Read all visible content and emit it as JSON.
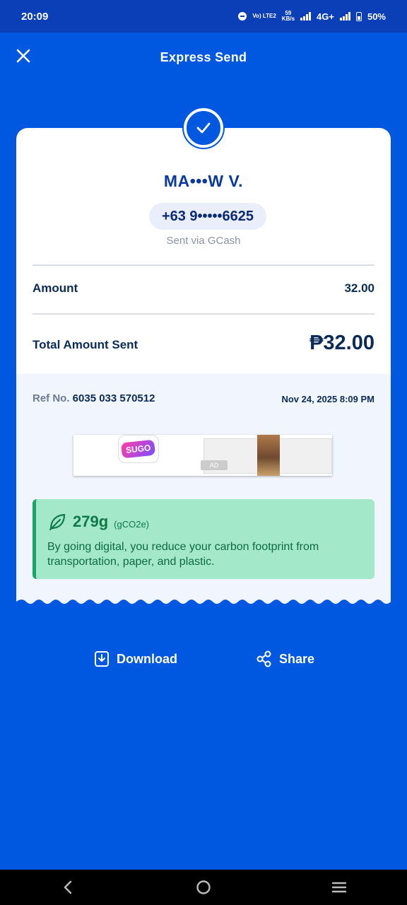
{
  "status_bar": {
    "time": "20:09",
    "volte": "Vo) LTE2",
    "speed_top": "59",
    "speed_bottom": "KB/s",
    "network": "4G+",
    "battery": "50%"
  },
  "header": {
    "title": "Express Send"
  },
  "recipient": {
    "name": "MA•••W V.",
    "phone": "+63 9•••••6625",
    "via": "Sent via GCash"
  },
  "summary": {
    "amount_label": "Amount",
    "amount_value": "32.00",
    "total_label": "Total Amount Sent",
    "total_value": "₱32.00"
  },
  "reference": {
    "label": "Ref No.",
    "number": "6035 033 570512",
    "date": "Nov 24, 2025 8:09 PM"
  },
  "ad": {
    "brand": "SUGO",
    "tag": "AD"
  },
  "eco": {
    "value": "279g",
    "unit": "(gCO2e)",
    "message": "By going digital, you reduce your carbon footprint from transportation, paper, and plastic."
  },
  "actions": {
    "download": "Download",
    "share": "Share"
  },
  "colors": {
    "brand_blue": "#0057e0",
    "eco_green": "#a3e8c9"
  }
}
